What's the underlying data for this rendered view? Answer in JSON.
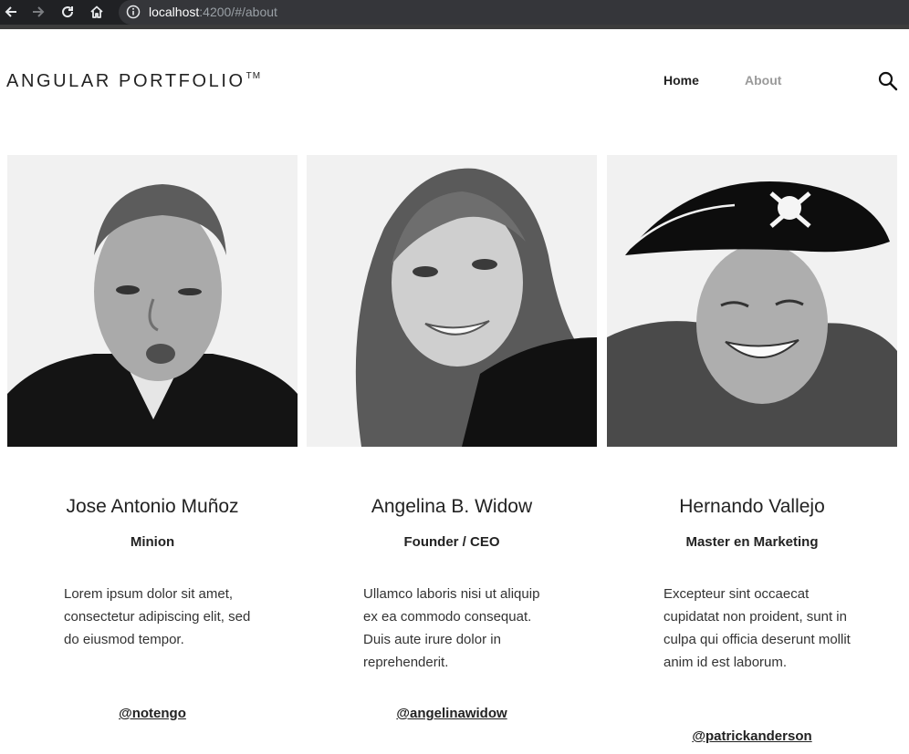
{
  "browser": {
    "url_host": "localhost",
    "url_rest": ":4200/#/about",
    "icons": [
      "back-arrow-icon",
      "forward-arrow-icon",
      "reload-icon",
      "home-icon",
      "info-icon"
    ]
  },
  "header": {
    "logo": "ANGULAR PORTFOLIO",
    "logo_tm": "TM",
    "nav": [
      {
        "label": "Home",
        "active": false
      },
      {
        "label": "About",
        "active": true
      }
    ],
    "search_icon": "search-icon"
  },
  "colors": {
    "text": "#222222",
    "nav_inactive": "#9a9a9a",
    "chrome_bg": "#202124",
    "url_bg": "#35363a"
  },
  "team": [
    {
      "name": "Jose Antonio Muñoz",
      "role": "Minion",
      "bio": "Lorem ipsum dolor sit amet, consectetur adipiscing elit, sed do eiusmod tempor.",
      "handle": "@notengo",
      "photo_icon": "portrait-photo"
    },
    {
      "name": "Angelina B. Widow",
      "role": "Founder / CEO",
      "bio": "Ullamco laboris nisi ut aliquip ex ea commodo consequat. Duis aute irure dolor in reprehenderit.",
      "handle": "@angelinawidow",
      "photo_icon": "portrait-photo"
    },
    {
      "name": "Hernando Vallejo",
      "role": "Master en Marketing",
      "bio": "Excepteur sint occaecat cupidatat non proident, sunt in culpa qui officia deserunt mollit anim id est laborum.",
      "handle": "@patrickanderson",
      "photo_icon": "portrait-photo"
    }
  ]
}
